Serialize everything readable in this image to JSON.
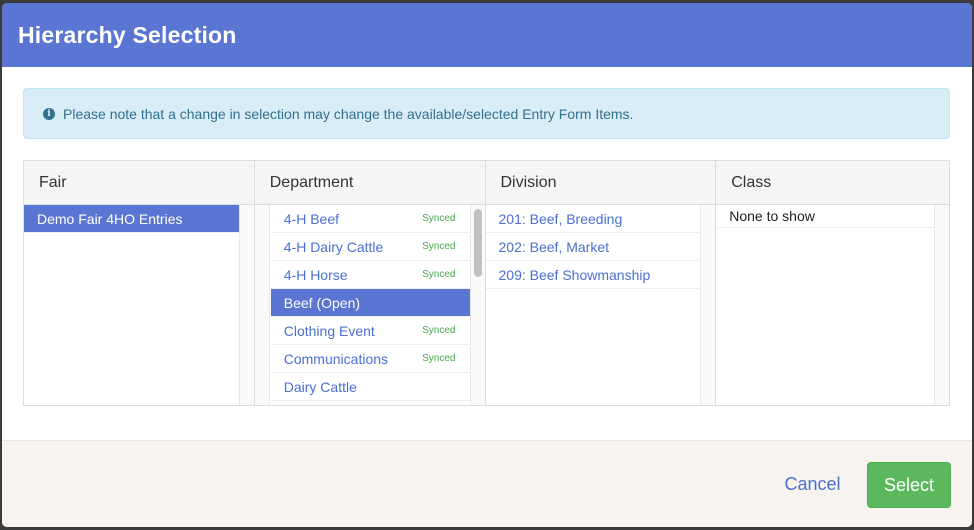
{
  "dialog": {
    "title": "Hierarchy Selection",
    "notice": "Please note that a change in selection may change the available/selected Entry Form Items."
  },
  "columns": {
    "fair": {
      "header": "Fair",
      "items": [
        {
          "label": "Demo Fair 4HO Entries",
          "selected": true
        }
      ]
    },
    "department": {
      "header": "Department",
      "items": [
        {
          "label": "4-H Beef",
          "status": "Synced"
        },
        {
          "label": "4-H Dairy Cattle",
          "status": "Synced"
        },
        {
          "label": "4-H Horse",
          "status": "Synced"
        },
        {
          "label": "Beef (Open)",
          "status": "",
          "selected": true
        },
        {
          "label": "Clothing Event",
          "status": "Synced"
        },
        {
          "label": "Communications",
          "status": "Synced"
        },
        {
          "label": "Dairy Cattle",
          "status": ""
        }
      ]
    },
    "division": {
      "header": "Division",
      "items": [
        {
          "label": "201: Beef, Breeding"
        },
        {
          "label": "202: Beef, Market"
        },
        {
          "label": "209: Beef Showmanship"
        }
      ]
    },
    "class": {
      "header": "Class",
      "empty_text": "None to show"
    }
  },
  "footer": {
    "cancel_label": "Cancel",
    "select_label": "Select"
  },
  "colors": {
    "header_bg": "#5a76d2",
    "selected_bg": "#5a76d2",
    "link": "#4a6fd1",
    "synced": "#4aa84a",
    "select_button": "#5cb85c"
  }
}
